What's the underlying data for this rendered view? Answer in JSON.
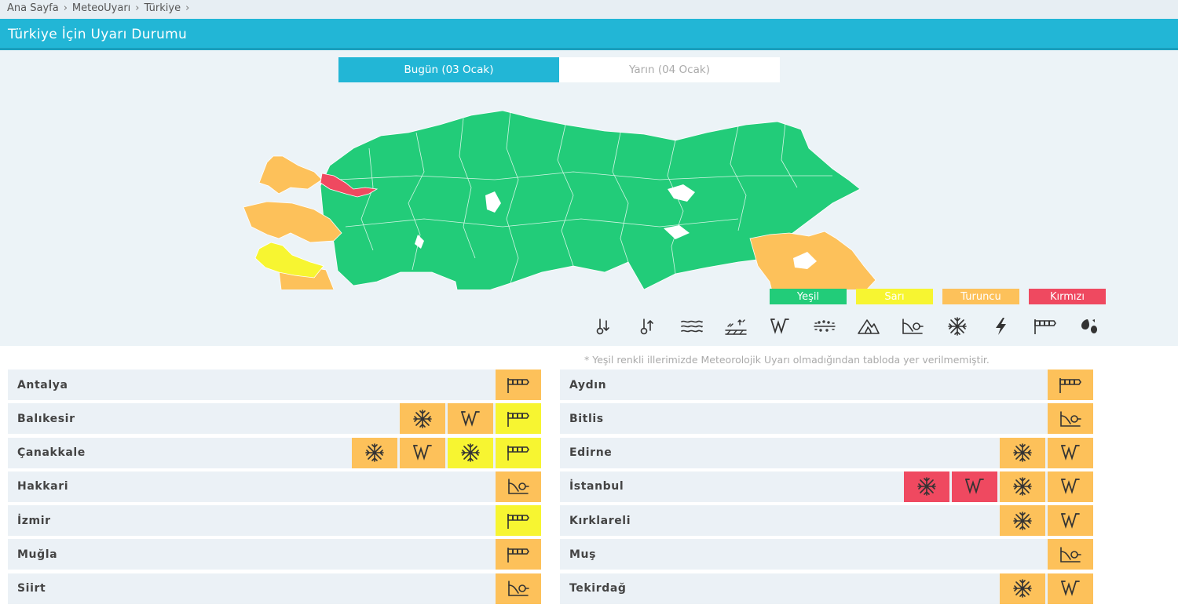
{
  "breadcrumb": [
    "Ana Sayfa",
    "MeteoUyarı",
    "Türkiye"
  ],
  "page_title": "Türkiye İçin Uyarı Durumu",
  "tabs": [
    {
      "label": "Bugün (03 Ocak)",
      "active": true
    },
    {
      "label": "Yarın (04 Ocak)",
      "active": false
    }
  ],
  "legend": [
    {
      "label": "Yeşil",
      "color": "#22cc79"
    },
    {
      "label": "Sarı",
      "color": "#f7f531"
    },
    {
      "label": "Turuncu",
      "color": "#fdc15a"
    },
    {
      "label": "Kırmızı",
      "color": "#ef4960"
    }
  ],
  "warning_types": [
    "soguk-icon",
    "sicak-icon",
    "sis-icon",
    "buzlanma-icon",
    "cig-icon",
    "toz-icon",
    "yangin-icon",
    "yagmur-icon",
    "kar-icon",
    "firtina-icon",
    "ruzgar-icon",
    "diger-icon"
  ],
  "note": "* Yeşil renkli illerimizde Meteorolojik Uyarı olmadığından tabloda yer verilmemiştir.",
  "colors": {
    "turuncu": "#fdc15a",
    "sari": "#f7f531",
    "kirmizi": "#ef4960",
    "yesil": "#22cc79",
    "accent": "#22b6d6"
  },
  "left_table": [
    {
      "city": "Antalya",
      "warnings": [
        [
          "ruzgar",
          "turuncu"
        ]
      ]
    },
    {
      "city": "Balıkesir",
      "warnings": [
        [
          "kar",
          "turuncu"
        ],
        [
          "cig",
          "turuncu"
        ],
        [
          "ruzgar",
          "sari"
        ]
      ]
    },
    {
      "city": "Çanakkale",
      "warnings": [
        [
          "kar",
          "turuncu"
        ],
        [
          "cig",
          "turuncu"
        ],
        [
          "kar",
          "sari"
        ],
        [
          "ruzgar",
          "sari"
        ]
      ]
    },
    {
      "city": "Hakkari",
      "warnings": [
        [
          "yagmur",
          "turuncu"
        ]
      ]
    },
    {
      "city": "İzmir",
      "warnings": [
        [
          "ruzgar",
          "sari"
        ]
      ]
    },
    {
      "city": "Muğla",
      "warnings": [
        [
          "ruzgar",
          "turuncu"
        ]
      ]
    },
    {
      "city": "Siirt",
      "warnings": [
        [
          "yagmur",
          "turuncu"
        ]
      ]
    }
  ],
  "right_table": [
    {
      "city": "Aydın",
      "warnings": [
        [
          "ruzgar",
          "turuncu"
        ]
      ]
    },
    {
      "city": "Bitlis",
      "warnings": [
        [
          "yagmur",
          "turuncu"
        ]
      ]
    },
    {
      "city": "Edirne",
      "warnings": [
        [
          "kar",
          "turuncu"
        ],
        [
          "cig",
          "turuncu"
        ]
      ]
    },
    {
      "city": "İstanbul",
      "warnings": [
        [
          "kar",
          "kirmizi"
        ],
        [
          "cig",
          "kirmizi"
        ],
        [
          "kar",
          "turuncu"
        ],
        [
          "cig",
          "turuncu"
        ]
      ]
    },
    {
      "city": "Kırklareli",
      "warnings": [
        [
          "kar",
          "turuncu"
        ],
        [
          "cig",
          "turuncu"
        ]
      ]
    },
    {
      "city": "Muş",
      "warnings": [
        [
          "yagmur",
          "turuncu"
        ]
      ]
    },
    {
      "city": "Tekirdağ",
      "warnings": [
        [
          "kar",
          "turuncu"
        ],
        [
          "cig",
          "turuncu"
        ]
      ]
    }
  ]
}
